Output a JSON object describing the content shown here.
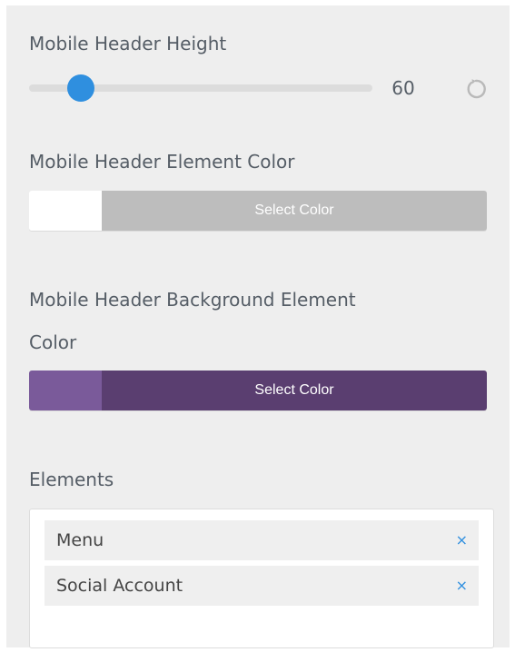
{
  "header_height": {
    "title": "Mobile Header Height",
    "value": "60",
    "min": 0,
    "max": 400,
    "current": 60,
    "reset_icon": "reset-icon"
  },
  "element_color": {
    "title": "Mobile Header Element Color",
    "swatch_color": "#ffffff",
    "button_color": "#bdbdbd",
    "button_label": "Select Color"
  },
  "background_color": {
    "title_line1": "Mobile Header Background Element",
    "title_line2": "Color",
    "swatch_color": "#7a5a9a",
    "button_color": "#5a3e70",
    "button_label": "Select Color"
  },
  "elements": {
    "title": "Elements",
    "items": [
      {
        "label": "Menu",
        "remove_label": "×"
      },
      {
        "label": "Social Account",
        "remove_label": "×"
      }
    ]
  },
  "colors": {
    "accent": "#2f8fdf",
    "panel_bg": "#eeeeee",
    "text": "#555d66"
  }
}
